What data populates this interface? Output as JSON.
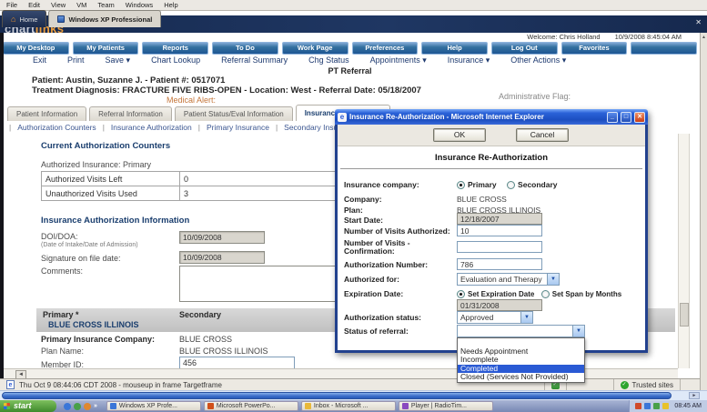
{
  "icons": {
    "close": "✕",
    "home": "⌂",
    "arrow_down": "▼",
    "arrow_up": "▲",
    "arrow_left": "◄",
    "arrow_right": "►",
    "check": "✓",
    "more": "»",
    "ie": "e"
  },
  "vm": {
    "menu": [
      "File",
      "Edit",
      "View",
      "VM",
      "Team",
      "Windows",
      "Help"
    ],
    "home_tab": "Home",
    "xp_tab": "Windows XP Professional"
  },
  "header": {
    "logo_chart": "chart",
    "logo_links": "links",
    "welcome": "Welcome: Chris Holland",
    "datetime": "10/9/2008 8:45:04 AM",
    "nav": [
      "My Desktop",
      "My Patients",
      "Reports",
      "To Do",
      "Work Page",
      "Preferences",
      "Help",
      "Log Out",
      "Favorites",
      ""
    ],
    "menu": [
      "Exit",
      "Print",
      "Save ▾",
      "Chart Lookup",
      "Referral Summary",
      "Chg Status",
      "Appointments ▾",
      "Insurance ▾",
      "Other Actions ▾"
    ]
  },
  "page": {
    "title": "PT Referral",
    "patient": "Patient: Austin, Suzanne J. - Patient #: 0517071",
    "diagnosis": "Treatment Diagnosis: FRACTURE FIVE RIBS-OPEN - Location: West - Referral Date: 05/18/2007",
    "medical_alert": "Medical Alert:",
    "admin_flag": "Administrative Flag:",
    "subtab_sep": "|",
    "tabs": [
      "Patient Information",
      "Referral Information",
      "Patient Status/Eval Information",
      "Insurance Information"
    ],
    "subtabs": [
      "Authorization Counters",
      "Insurance Authorization",
      "Primary Insurance",
      "Secondary Insuran"
    ]
  },
  "counters": {
    "heading": "Current Authorization Counters",
    "authorized_insurance": "Authorized Insurance: Primary",
    "rows": [
      {
        "label": "Authorized Visits Left",
        "value": "0"
      },
      {
        "label": "Unauthorized Visits Used",
        "value": "3"
      }
    ]
  },
  "auth_info": {
    "heading": "Insurance Authorization Information",
    "doi_label": "DOI/DOA:",
    "doi_sublabel": "(Date of Intake/Date of Admission)",
    "doi_value": "10/09/2008",
    "signature_label": "Signature on file date:",
    "signature_value": "10/09/2008",
    "comments_label": "Comments:"
  },
  "insurance_grid": {
    "primary_header": "Primary *",
    "primary_plan": "BLUE CROSS ILLINOIS",
    "secondary_header": "Secondary",
    "company_label": "Primary Insurance Company:",
    "company_value": "BLUE CROSS",
    "plan_label": "Plan Name:",
    "plan_value": "BLUE CROSS ILLINOIS",
    "member_label": "Member ID:",
    "member_value": "456"
  },
  "dialog": {
    "title": "Insurance Re-Authorization - Microsoft Internet Explorer",
    "ok": "OK",
    "cancel": "Cancel",
    "heading": "Insurance Re-Authorization",
    "company_label": "Insurance company:",
    "radio_primary": "Primary",
    "radio_secondary": "Secondary",
    "company2_label": "Company:",
    "company2_value": "BLUE CROSS",
    "plan_label": "Plan:",
    "plan_value": "BLUE CROSS ILLINOIS",
    "start_label": "Start Date:",
    "start_value": "12/18/2007",
    "visits_label": "Number of Visits Authorized:",
    "visits_value": "10",
    "confirm_label": "Number of Visits - Confirmation:",
    "authnum_label": "Authorization Number:",
    "authnum_value": "786",
    "authfor_label": "Authorized for:",
    "authfor_value": "Evaluation and Therapy",
    "exp_label": "Expiration Date:",
    "radio_expdate": "Set Expiration Date",
    "radio_span": "Set Span by Months",
    "exp_value": "01/31/2008",
    "status_label": "Authorization status:",
    "status_value": "Approved",
    "referral_label": "Status of referral:",
    "dropdown_options": [
      "",
      "Needs Appointment",
      "Incomplete",
      "Completed",
      "Closed (Services Not Provided)"
    ],
    "dropdown_selected": "Completed"
  },
  "statusbar": {
    "message": "Thu Oct 9 08:44:06 CDT 2008 - mouseup in frame Targetframe",
    "trusted": "Trusted sites"
  },
  "taskbar": {
    "start": "start",
    "items": [
      "Windows XP Profe...",
      "Microsoft PowerPo...",
      "Inbox - Microsoft ...",
      "Player | RadioTim..."
    ],
    "clock": "08:45 AM"
  },
  "colors": {
    "navy": "#1a3e6e",
    "button_blue": "#2a69aa",
    "orange": "#e89b3c",
    "highlight_blue": "#2a5ad4",
    "trusted_green": "#2da52d"
  }
}
